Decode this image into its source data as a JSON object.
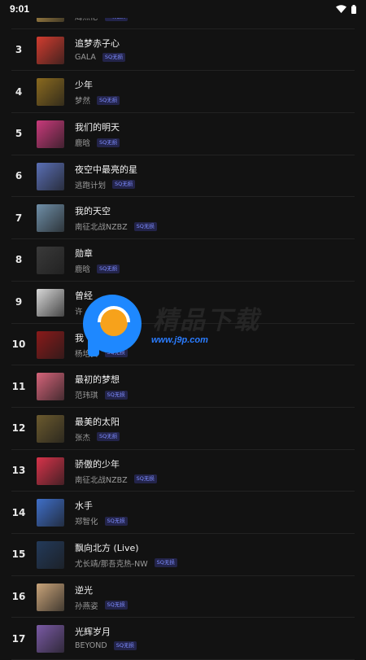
{
  "status": {
    "time": "9:01"
  },
  "watermark": {
    "brand": "精品下载",
    "url": "www.j9p.com"
  },
  "badge_label": "SQ无损",
  "songs": [
    {
      "rank": "",
      "title": "",
      "artist": "周杰伦",
      "color": "#c9a14f"
    },
    {
      "rank": "3",
      "title": "追梦赤子心",
      "artist": "GALA",
      "color": "#d23c2f"
    },
    {
      "rank": "4",
      "title": "少年",
      "artist": "梦然",
      "color": "#8a6a1f"
    },
    {
      "rank": "5",
      "title": "我们的明天",
      "artist": "鹿晗",
      "color": "#c93a7b"
    },
    {
      "rank": "6",
      "title": "夜空中最亮的星",
      "artist": "逃跑计划",
      "color": "#5a6fb5"
    },
    {
      "rank": "7",
      "title": "我的天空",
      "artist": "南征北战NZBZ",
      "color": "#6f8fa8"
    },
    {
      "rank": "8",
      "title": "勋章",
      "artist": "鹿晗",
      "color": "#3a3a3a"
    },
    {
      "rank": "9",
      "title": "曾经",
      "artist": "许",
      "color": "#d8d8d8"
    },
    {
      "rank": "10",
      "title": "我",
      "artist": "杨培安",
      "color": "#8a1a1a"
    },
    {
      "rank": "11",
      "title": "最初的梦想",
      "artist": "范玮琪",
      "color": "#d6647a"
    },
    {
      "rank": "12",
      "title": "最美的太阳",
      "artist": "张杰",
      "color": "#6b5a2e"
    },
    {
      "rank": "13",
      "title": "骄傲的少年",
      "artist": "南征北战NZBZ",
      "color": "#d8334a"
    },
    {
      "rank": "14",
      "title": "水手",
      "artist": "郑智化",
      "color": "#3f6fc9"
    },
    {
      "rank": "15",
      "title": "飘向北方 (Live)",
      "artist": "尤长靖/那吾克热-NW",
      "color": "#233a5a"
    },
    {
      "rank": "16",
      "title": "逆光",
      "artist": "孙燕姿",
      "color": "#c9a47a"
    },
    {
      "rank": "17",
      "title": "光辉岁月",
      "artist": "BEYOND",
      "color": "#7a5aa5"
    }
  ]
}
